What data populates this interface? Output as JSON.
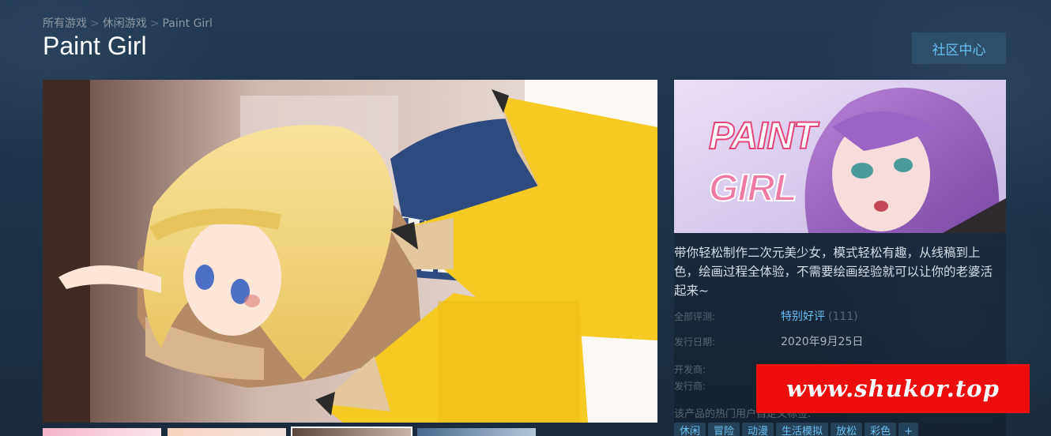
{
  "breadcrumb": {
    "items": [
      "所有游戏",
      "休闲游戏",
      "Paint Girl"
    ],
    "separator": ">"
  },
  "title": "Paint Girl",
  "community_button": "社区中心",
  "description": "带你轻松制作二次元美少女，模式轻松有趣，从线稿到上色，绘画过程全体验，不需要绘画经验就可以让你的老婆活起来~",
  "capsule_logo": {
    "line1": "PAINT",
    "line2": "GIRL"
  },
  "reviews": {
    "label": "全部评测:",
    "summary": "特别好评",
    "count": "(111)"
  },
  "release": {
    "label": "发行日期:",
    "value": "2020年9月25日"
  },
  "developer": {
    "label": "开发商:"
  },
  "publisher": {
    "label": "发行商:"
  },
  "tags": {
    "label": "该产品的热门用户自定义标签:",
    "items": [
      "休闲",
      "冒险",
      "动漫",
      "生活模拟",
      "放松",
      "彩色",
      "+"
    ]
  },
  "watermark": "www.shukor.top",
  "colors": {
    "accent": "#67c1f5",
    "background": "#1b2838",
    "watermark": "#ee0d0d"
  }
}
